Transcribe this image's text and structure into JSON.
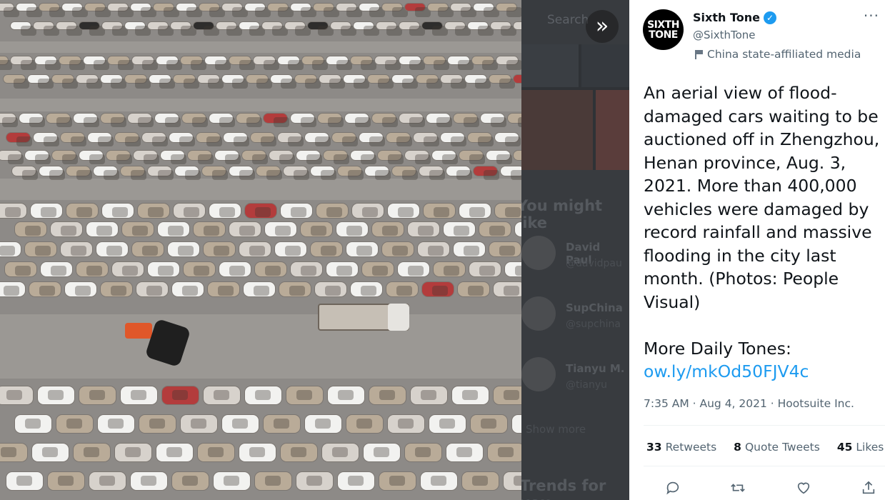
{
  "tweet": {
    "display_name": "Sixth Tone",
    "handle": "@SixthTone",
    "avatar_text_1": "SIXTH",
    "avatar_text_2": "TONE",
    "affiliation": "China state-affiliated media",
    "body": "An aerial view of flood-damaged cars waiting to be auctioned off in Zhengzhou, Henan province, Aug. 3, 2021. More than 400,000 vehicles were damaged by record rainfall and massive flooding in the city last month. (Photos: People Visual)\n\nMore Daily Tones:",
    "link": "ow.ly/mkOd50FJV4c",
    "time": "7:35 AM",
    "date": "Aug 4, 2021",
    "source": "Hootsuite Inc.",
    "separator": " · ",
    "retweets_count": "33",
    "retweets_label": "Retweets",
    "quotes_count": "8",
    "quotes_label": "Quote Tweets",
    "likes_count": "45",
    "likes_label": "Likes"
  },
  "background": {
    "search_placeholder": "Search",
    "you_might_like": "You might like",
    "suggestions": [
      {
        "name": "David Paul",
        "handle": "@davidpau"
      },
      {
        "name": "SupChina",
        "handle": "@supchina"
      },
      {
        "name": "Tianyu M.",
        "handle": "@tianyu"
      }
    ],
    "show_more": "Show more",
    "trends": "Trends for you"
  },
  "icons": [
    "expand-icon",
    "verified-badge-icon",
    "state-media-flag-icon",
    "more-options-icon",
    "reply-icon",
    "retweet-icon",
    "like-icon",
    "share-icon"
  ],
  "colors": {
    "accent": "#1d9bf0",
    "secondary_text": "#536471",
    "primary_text": "#0f1419"
  }
}
